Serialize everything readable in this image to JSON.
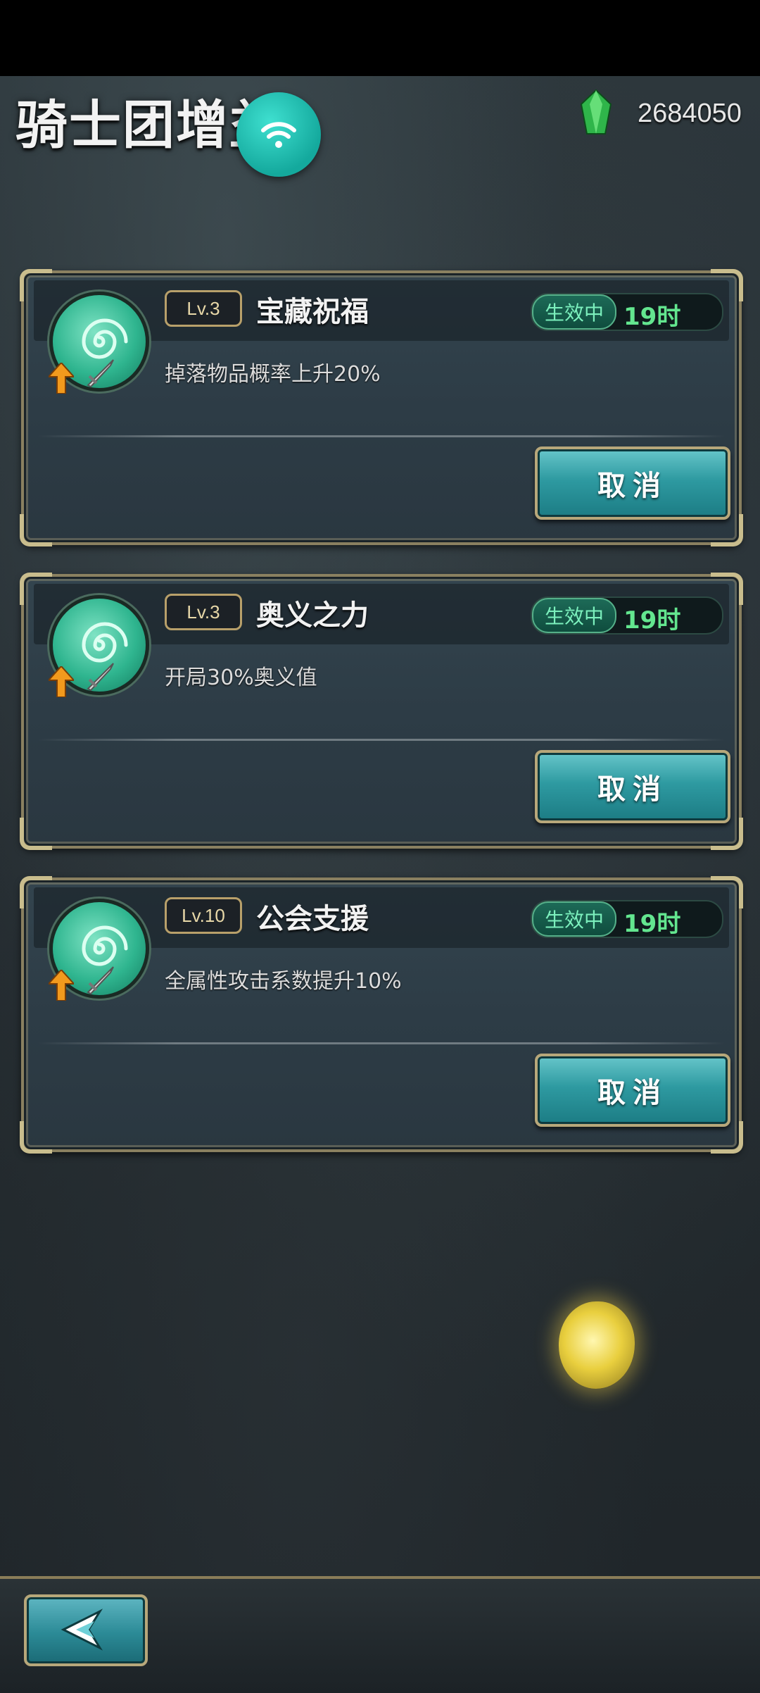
{
  "header": {
    "title": "骑士团增益",
    "currency_icon": "green-gem-icon",
    "currency_value": "2684050",
    "wifi_icon": "wifi-icon"
  },
  "buffs": [
    {
      "level": "Lv.3",
      "name": "宝藏祝福",
      "status": "生效中",
      "time": "19时",
      "description": "掉落物品概率上升20%",
      "action": "取消"
    },
    {
      "level": "Lv.3",
      "name": "奥义之力",
      "status": "生效中",
      "time": "19时",
      "description": "开局30%奥义值",
      "action": "取消"
    },
    {
      "level": "Lv.10",
      "name": "公会支援",
      "status": "生效中",
      "time": "19时",
      "description": "全属性攻击系数提升10%",
      "action": "取消"
    }
  ],
  "floating": {
    "orb_icon": "glowing-orb-icon"
  },
  "footer": {
    "back_icon": "back-arrow-icon"
  },
  "colors": {
    "accent_teal": "#2e9aa1",
    "status_green": "#63e68f",
    "gold_border": "#b7a77a"
  }
}
